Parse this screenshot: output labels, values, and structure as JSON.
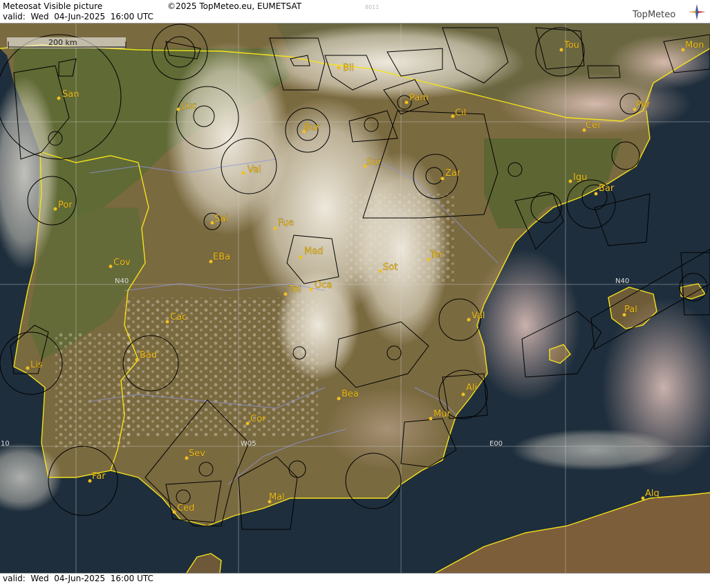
{
  "header": {
    "title": "Meteosat Visible picture",
    "copyright": "©2025 TopMeteo.eu, EUMETSAT",
    "valid": "valid:  Wed  04-Jun-2025  16:00 UTC",
    "code": "8011",
    "logo_text": "TopMeteo"
  },
  "footer": {
    "valid": "valid:  Wed  04-Jun-2025  16:00 UTC"
  },
  "map": {
    "scale_label": "200 km",
    "grid_labels": {
      "n40_left": "N40",
      "n40_right": "N40",
      "w05": "W05",
      "e00": "E00",
      "w10": "10"
    },
    "places": [
      {
        "name": "San"
      },
      {
        "name": "Luc"
      },
      {
        "name": "Bil"
      },
      {
        "name": "Pam"
      },
      {
        "name": "Tou"
      },
      {
        "name": "Mon"
      },
      {
        "name": "Per"
      },
      {
        "name": "Cil"
      },
      {
        "name": "Bur"
      },
      {
        "name": "Cer"
      },
      {
        "name": "Val"
      },
      {
        "name": "Sor"
      },
      {
        "name": "Zar"
      },
      {
        "name": "Igu"
      },
      {
        "name": "Bar"
      },
      {
        "name": "Por"
      },
      {
        "name": "Sal"
      },
      {
        "name": "Fue"
      },
      {
        "name": "Mad"
      },
      {
        "name": "Ter"
      },
      {
        "name": "Cov"
      },
      {
        "name": "EBa"
      },
      {
        "name": "Sot"
      },
      {
        "name": "Tol"
      },
      {
        "name": "Oca"
      },
      {
        "name": "Pal"
      },
      {
        "name": "Cac"
      },
      {
        "name": "Val"
      },
      {
        "name": "Lis"
      },
      {
        "name": "Bad"
      },
      {
        "name": "Ali"
      },
      {
        "name": "Bea"
      },
      {
        "name": "Mur"
      },
      {
        "name": "Cor"
      },
      {
        "name": "Sev"
      },
      {
        "name": "Far"
      },
      {
        "name": "Mal"
      },
      {
        "name": "Alg"
      },
      {
        "name": "Ced"
      }
    ]
  }
}
